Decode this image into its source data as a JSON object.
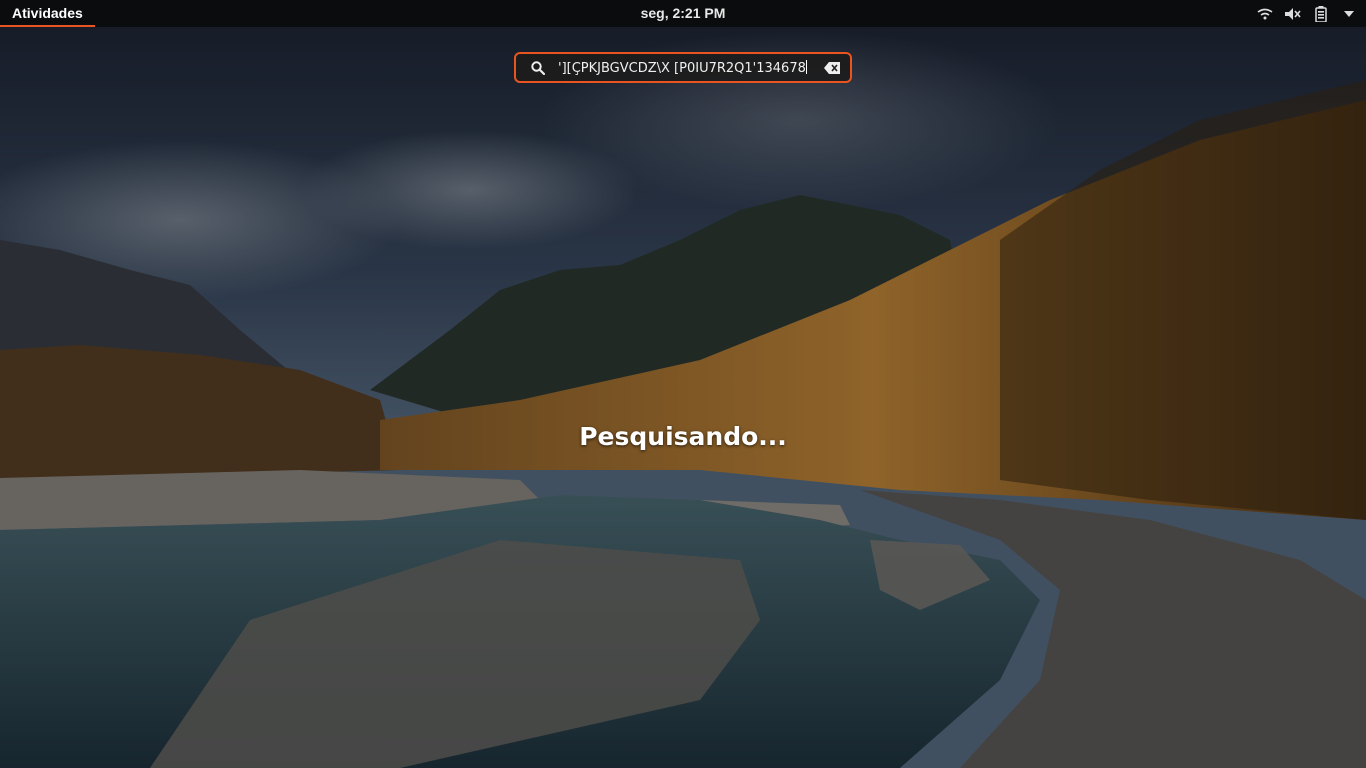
{
  "topbar": {
    "activities_label": "Atividades",
    "clock": "seg,  2:21 PM",
    "accent": "#e95420"
  },
  "system_tray": [
    {
      "name": "network-icon"
    },
    {
      "name": "volume-muted-icon"
    },
    {
      "name": "battery-icon"
    },
    {
      "name": "chevron-down-icon"
    }
  ],
  "search": {
    "value": "'][ÇPKJBGVCDZ\\X [P0IU7R2Q1'134678",
    "icon": "search-icon",
    "clear_icon": "clear-text-icon"
  },
  "status": {
    "text": "Pesquisando..."
  }
}
